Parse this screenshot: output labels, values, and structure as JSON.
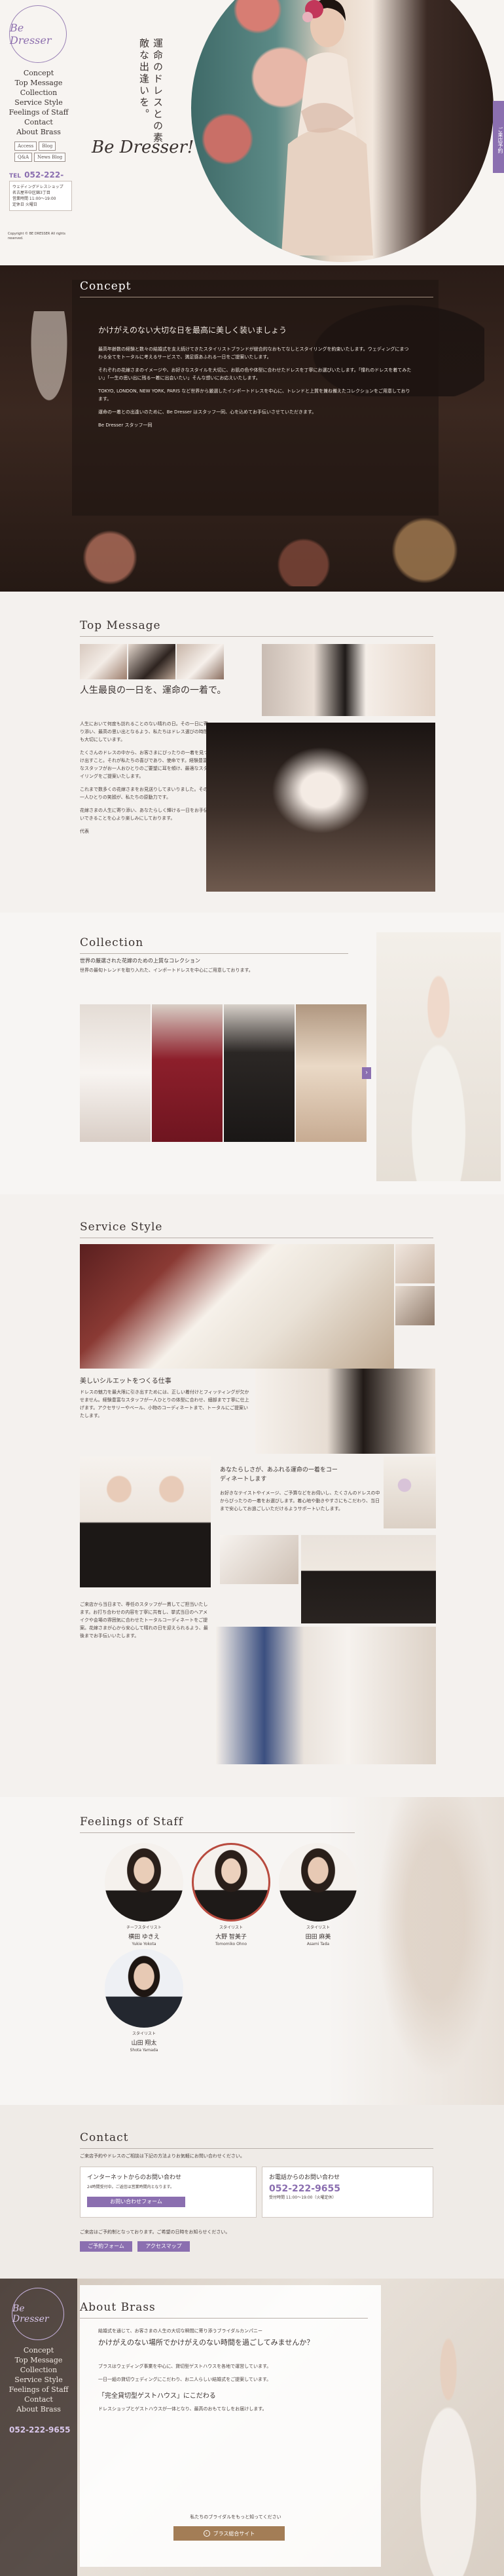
{
  "brand": {
    "logo_text": "Be Dresser",
    "tagline_script": "Be Dresser!"
  },
  "hero": {
    "vertical_copy": "運命のドレスとの素敵な出逢いを。",
    "side_tab": "ご来店予約"
  },
  "nav": {
    "items": [
      "Concept",
      "Top Message",
      "Collection",
      "Service Style",
      "Feelings of Staff",
      "Contact",
      "About Brass"
    ],
    "sub_buttons": [
      "Access",
      "Blog",
      "Q&A",
      "News Blog"
    ],
    "tel_label": "TEL",
    "tel": "052-222-9655",
    "info_lines": [
      "ウェディングドレスショップ",
      "名古屋市中区錦3丁目",
      "営業時間 11:00〜19:00",
      "定休日 火曜日"
    ],
    "copyright": "Copyright © BE DRESSER All rights reserved."
  },
  "concept": {
    "title": "Concept",
    "heading": "かけがえのない大切な日を最高に美しく装いましょう",
    "paragraphs": [
      "最高年齢数の経験と数々の結婚式を支え続けてきたスタイリストブランドが総合的なおもてなしとスタイリングを約束いたします。ウェディングにまつわる全てをトータルに考えるサービスで、満足感あふれる一日をご提案いたします。",
      "それぞれの花嫁さまのイメージや、お好きなスタイルを大切に、お肌の色や体型に合わせたドレスを丁寧にお選びいたします。「憧れのドレスを着てみたい」「一生の思い出に残る一着に出会いたい」そんな想いにお応えいたします。",
      "TOKYO, LONDON, NEW YORK, PARIS など世界から厳選したインポートドレスを中心に、トレンドと上質を兼ね備えたコレクションをご用意しております。",
      "運命の一着との出逢いのために、Be Dresser はスタッフ一同、心を込めてお手伝いさせていただきます。"
    ],
    "signature": "Be Dresser スタッフ一同"
  },
  "top_message": {
    "title": "Top Message",
    "heading": "人生最良の一日を、運命の一着で。",
    "paragraphs": [
      "人生において何度も訪れることのない晴れの日。その一日に寄り添い、最高の思い出となるよう、私たちはドレス選びの時間も大切にしています。",
      "たくさんのドレスの中から、お客さまにぴったりの一着を見つけ出すこと。それが私たちの喜びであり、使命です。経験豊富なスタッフがお一人おひとりのご要望に耳を傾け、最適なスタイリングをご提案いたします。",
      "これまで数多くの花嫁さまをお見送りしてまいりました。その一人ひとりの笑顔が、私たちの原動力です。",
      "花嫁さまの人生に寄り添い、あなたらしく輝ける一日をお手伝いできることを心より楽しみにしております。"
    ],
    "signature": "代表"
  },
  "collection": {
    "title": "Collection",
    "subheading": "世界の厳選された花嫁のための上質なコレクション",
    "lead": "世界の最旬トレンドを取り入れた、インポートドレスを中心にご用意しております。"
  },
  "service": {
    "title": "Service Style",
    "block1_heading": "美しいシルエットをつくる仕事",
    "block1_text": "ドレスの魅力を最大限に引き出すためには、正しい着付けとフィッティングが欠かせません。経験豊富なスタッフが一人ひとりの体型に合わせ、細部まで丁寧に仕上げます。アクセサリーやベール、小物のコーディネートまで、トータルにご提案いたします。",
    "block2_heading": "あなたらしさが、あふれる運命の一着をコーディネートします",
    "block2_text": "お好きなテイストやイメージ、ご予算などをお伺いし、たくさんのドレスの中からぴったりの一着をお選びします。着心地や動きやすさにもこだわり、当日まで安心してお過ごしいただけるようサポートいたします。",
    "block3_text": "ご来店から当日まで、専任のスタッフが一貫してご担当いたします。お打ち合わせの内容を丁寧に共有し、挙式当日のヘアメイクや会場の雰囲気に合わせたトータルコーディネートをご提案。花嫁さまが心から安心して晴れの日を迎えられるよう、最後までお手伝いいたします。"
  },
  "staff": {
    "title": "Feelings of Staff",
    "members": [
      {
        "role": "チーフスタイリスト",
        "name": "横田 ゆきえ",
        "romaji": "Yukie Yokota"
      },
      {
        "role": "スタイリスト",
        "name": "大野 智美子",
        "romaji": "Tomomiko Ohno"
      },
      {
        "role": "スタイリスト",
        "name": "田田 麻美",
        "romaji": "Asami Tada"
      },
      {
        "role": "スタイリスト",
        "name": "山田 翔太",
        "romaji": "Shota Yamada"
      }
    ]
  },
  "contact": {
    "title": "Contact",
    "lead": "ご来店予約やドレスのご相談は下記の方法よりお気軽にお問い合わせください。",
    "web_box_title": "インターネットからのお問い合わせ",
    "web_box_text": "24時間受付中。ご返信は営業時間内となります。",
    "web_button": "お問い合わせフォーム",
    "tel_box_title": "お電話からのお問い合わせ",
    "tel_box_number": "052-222-9655",
    "tel_box_text": "受付時間 11:00〜19:00（火曜定休）",
    "bottom_text": "ご来店はご予約制となっております。ご希望の日時をお知らせください。",
    "buttons": [
      "ご予約フォーム",
      "アクセスマップ"
    ]
  },
  "about": {
    "title": "About Brass",
    "intro": "結婚式を通じて、お客さまの人生の大切な瞬間に寄り添うブライダルカンパニー",
    "heading": "かけがえのない場所でかけがえのない時間を過ごしてみませんか？",
    "paragraphs": [
      "ブラスはウェディング事業を中心に、貸切型ゲストハウスを各地で運営しています。",
      "一日一組の貸切ウェディングにこだわり、お二人らしい結婚式をご提案しています。",
      "「完全貸切型ゲストハウス」にこだわる",
      "ドレスショップとゲストハウスが一体となり、最高のおもてなしをお届けします。"
    ],
    "button": "ブラス総合サイト",
    "button_lead": "私たちのブライダルをもっと知ってください"
  },
  "colors": {
    "accent": "#8b6fb0",
    "dark": "#2a1e1a",
    "bg": "#f4f1ee"
  }
}
